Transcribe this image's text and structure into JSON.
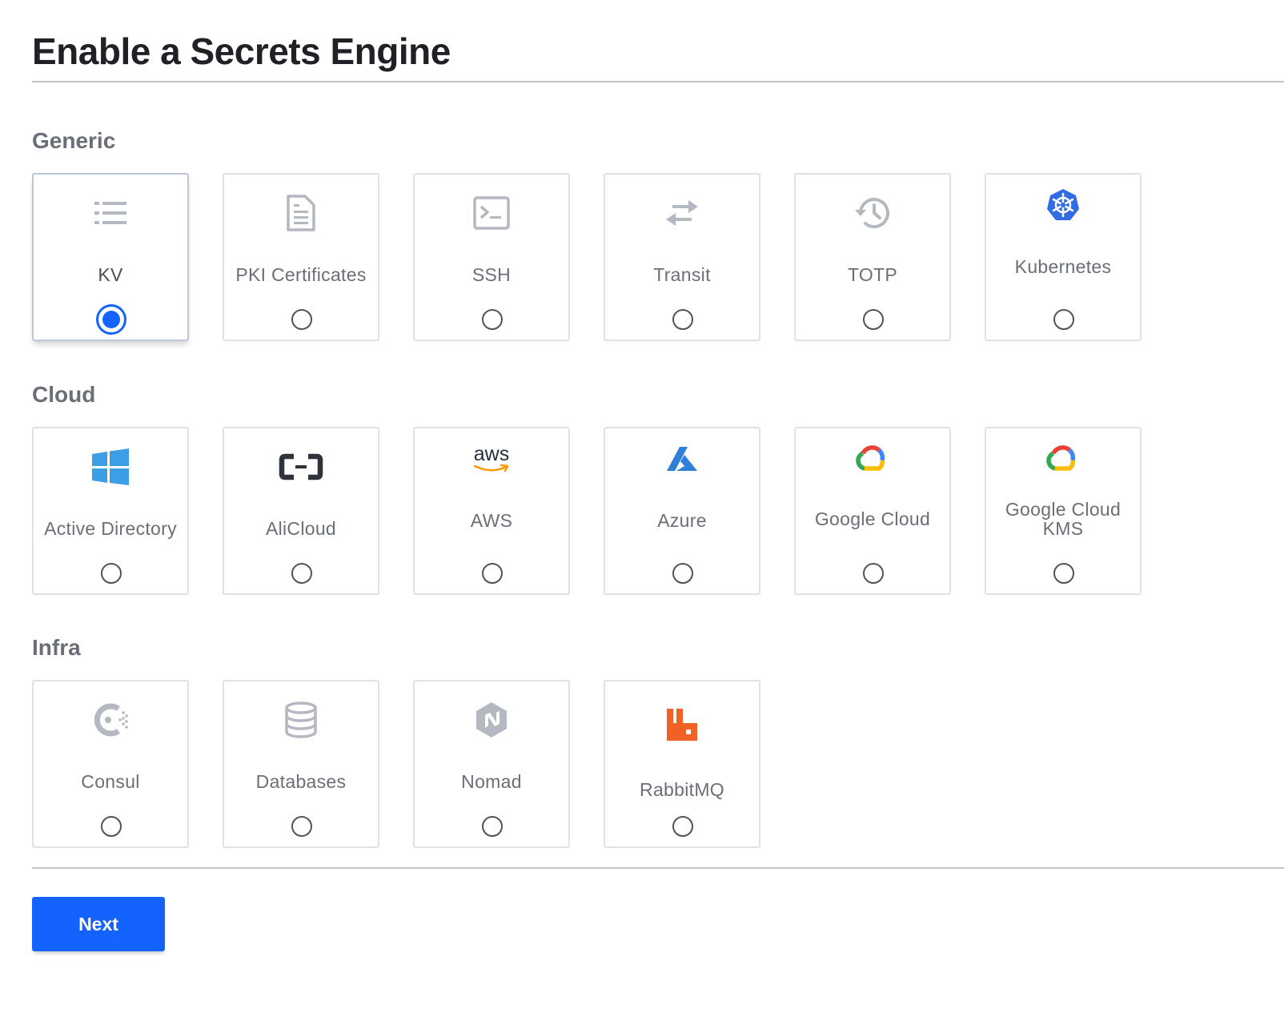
{
  "page": {
    "title": "Enable a Secrets Engine"
  },
  "sections": [
    {
      "title": "Generic",
      "engines": [
        {
          "label": "KV",
          "icon": "list-icon",
          "selected": true
        },
        {
          "label": "PKI Certificates",
          "icon": "document-icon",
          "selected": false
        },
        {
          "label": "SSH",
          "icon": "terminal-icon",
          "selected": false
        },
        {
          "label": "Transit",
          "icon": "swap-arrows-icon",
          "selected": false
        },
        {
          "label": "TOTP",
          "icon": "history-clock-icon",
          "selected": false
        },
        {
          "label": "Kubernetes",
          "icon": "kubernetes-icon",
          "selected": false
        }
      ]
    },
    {
      "title": "Cloud",
      "engines": [
        {
          "label": "Active Directory",
          "icon": "windows-icon",
          "selected": false
        },
        {
          "label": "AliCloud",
          "icon": "alicloud-icon",
          "selected": false
        },
        {
          "label": "AWS",
          "icon": "aws-icon",
          "icon_text": "aws",
          "selected": false
        },
        {
          "label": "Azure",
          "icon": "azure-icon",
          "selected": false
        },
        {
          "label": "Google Cloud",
          "icon": "google-cloud-icon",
          "selected": false
        },
        {
          "label": "Google Cloud KMS",
          "icon": "google-cloud-icon",
          "selected": false
        }
      ]
    },
    {
      "title": "Infra",
      "engines": [
        {
          "label": "Consul",
          "icon": "consul-icon",
          "selected": false
        },
        {
          "label": "Databases",
          "icon": "database-icon",
          "selected": false
        },
        {
          "label": "Nomad",
          "icon": "nomad-icon",
          "selected": false
        },
        {
          "label": "RabbitMQ",
          "icon": "rabbitmq-icon",
          "selected": false
        }
      ]
    }
  ],
  "actions": {
    "next_label": "Next"
  },
  "colors": {
    "primary": "#1563ff",
    "icon_gray": "#b4b8c1",
    "label_gray": "#6a6e77",
    "kubernetes": "#326ce5",
    "windows": "#3c9fe6",
    "azure": "#2f7fd9",
    "aws_orange": "#ff9900",
    "rabbitmq": "#f06125"
  }
}
